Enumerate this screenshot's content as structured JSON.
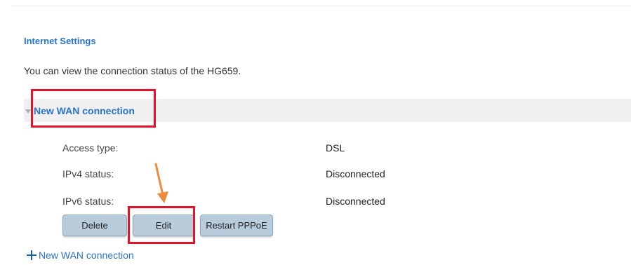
{
  "section": {
    "title": "Internet Settings",
    "description": "You can view the connection status of the HG659."
  },
  "connection": {
    "header_label": "New WAN connection",
    "rows": [
      {
        "label": "Access type:",
        "value": "DSL"
      },
      {
        "label": "IPv4 status:",
        "value": "Disconnected"
      },
      {
        "label": "IPv6 status:",
        "value": "Disconnected"
      }
    ],
    "buttons": {
      "delete": "Delete",
      "edit": "Edit",
      "restart": "Restart PPPoE"
    }
  },
  "add_connection": {
    "label": "New WAN connection"
  },
  "colors": {
    "link_blue": "#2a73c9",
    "highlight_red": "#e3132b",
    "annotation_arrow": "#ef8a3c",
    "button_fill": "#b9ccdc",
    "header_fill": "#f0f0f0"
  },
  "icons": {
    "collapse": "triangle-down-icon",
    "add": "plus-icon",
    "annotation": "arrow-down-icon"
  }
}
